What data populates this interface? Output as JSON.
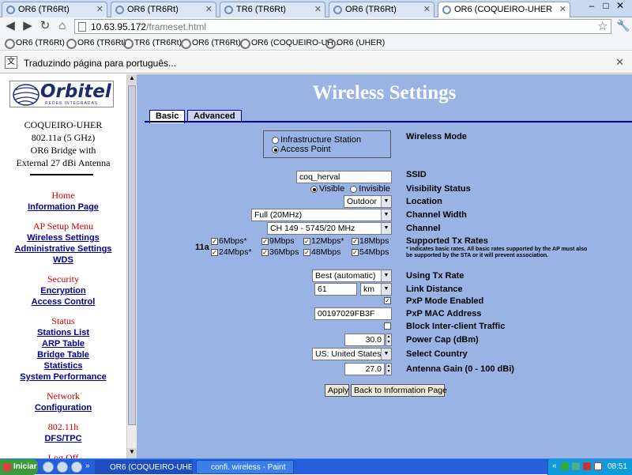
{
  "browser": {
    "tabs": [
      {
        "label": "OR6 (TR6Rt)",
        "active": false
      },
      {
        "label": "OR6 (TR6Rt)",
        "active": false
      },
      {
        "label": "TR6 (TR6Rt)",
        "active": false
      },
      {
        "label": "OR6 (TR6Rt)",
        "active": false
      },
      {
        "label": "OR6 (COQUEIRO-UHER",
        "active": true
      }
    ],
    "url_host": "10.63.95.172",
    "url_path": "/frameset.html",
    "bookmarks": [
      "OR6 (TR6Rt)",
      "OR6 (TR6Rt)",
      "TR6 (TR6Rt)",
      "OR6 (TR6Rt)",
      "OR6 (COQUEIRO-UH...",
      "OR6 (UHER)"
    ],
    "translate_text": "Traduzindo página para português..."
  },
  "sidebar": {
    "logo_text": "Orbitel",
    "logo_sub": "REDES INTEGRADAS",
    "device_lines": [
      "COQUEIRO-UHER",
      "802.11a (5 GHz)",
      "OR6 Bridge with",
      "External 27 dBi Antenna"
    ],
    "home": "Home",
    "info_page": "Information Page",
    "ap_setup": "AP Setup Menu",
    "wireless_settings": "Wireless Settings",
    "admin_settings": "Administrative Settings",
    "wds": "WDS",
    "security": "Security",
    "encryption": "Encryption",
    "access_control": "Access Control",
    "status": "Status",
    "stations_list": "Stations List",
    "arp_table": "ARP Table",
    "bridge_table": "Bridge Table",
    "statistics": "Statistics",
    "system_performance": "System Performance",
    "network": "Network",
    "configuration": "Configuration",
    "dot11h": "802.11h",
    "dfs_tpc": "DFS/TPC",
    "logoff": "Log Off"
  },
  "main": {
    "title": "Wireless Settings",
    "tab_basic": "Basic",
    "tab_advanced": "Advanced",
    "mode_infra": "Infrastructure Station",
    "mode_ap": "Access Point",
    "mode_selected": "Access Point",
    "ssid": "coq_herval",
    "visible": "Visible",
    "invisible": "Invisible",
    "visibility_selected": "Visible",
    "location": "Outdoor",
    "channel_width": "Full (20MHz)",
    "channel": "CH 149 - 5745/20 MHz",
    "band_label": "11a",
    "rates": [
      {
        "label": "6Mbps*",
        "checked": true
      },
      {
        "label": "9Mbps",
        "checked": true
      },
      {
        "label": "12Mbps*",
        "checked": true
      },
      {
        "label": "18Mbps",
        "checked": true
      },
      {
        "label": "24Mbps*",
        "checked": true
      },
      {
        "label": "36Mbps",
        "checked": true
      },
      {
        "label": "48Mbps",
        "checked": true
      },
      {
        "label": "54Mbps",
        "checked": true
      }
    ],
    "tx_rate": "Best (automatic)",
    "link_distance": "61",
    "link_unit": "km",
    "pxp_enabled": true,
    "pxp_mac": "00197029FB3F",
    "block_inter_client": false,
    "power_cap": "30.0",
    "country": "US: United States",
    "antenna_gain": "27.0",
    "labels": {
      "wireless_mode": "Wireless Mode",
      "ssid": "SSID",
      "visibility": "Visibility Status",
      "location": "Location",
      "channel_width": "Channel Width",
      "channel": "Channel",
      "supported_rates": "Supported Tx Rates",
      "rates_note": "* indicates basic rates. All basic rates supported by the AP must also be supported by the STA or it will prevent association.",
      "using_tx_rate": "Using Tx Rate",
      "link_distance": "Link Distance",
      "pxp_enabled": "PxP Mode Enabled",
      "pxp_mac": "PxP MAC Address",
      "block": "Block Inter-client Traffic",
      "power_cap": "Power Cap (dBm)",
      "country": "Select Country",
      "antenna_gain": "Antenna Gain (0 - 100 dBi)"
    },
    "apply": "Apply",
    "back": "Back to Information Page"
  },
  "taskbar": {
    "start": "Iniciar",
    "tasks": [
      {
        "label": "OR6 (COQUEIRO-UHE...",
        "active": true
      },
      {
        "label": "confi. wireless - Paint",
        "active": false
      }
    ],
    "clock": "08:51"
  }
}
